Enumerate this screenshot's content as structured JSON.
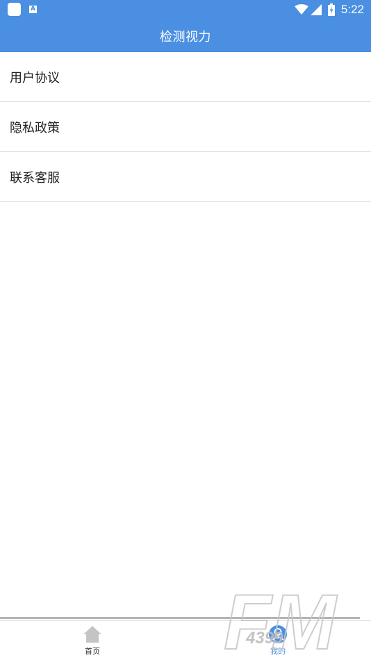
{
  "colors": {
    "header_bg": "#4a8fe2",
    "accent": "#4a8fe2",
    "divider": "#d6d6d6",
    "text": "#222222"
  },
  "status_bar": {
    "time": "5:22",
    "notification_icons": [
      "app-icon",
      "a-icon"
    ],
    "a_icon_letter": "A",
    "system_icons": [
      "wifi-icon",
      "signal-icon",
      "battery-icon"
    ]
  },
  "app_bar": {
    "title": "检测视力"
  },
  "menu": {
    "items": [
      {
        "label": "用户协议"
      },
      {
        "label": "隐私政策"
      },
      {
        "label": "联系客服"
      }
    ]
  },
  "bottom_nav": {
    "tabs": [
      {
        "label": "首页",
        "icon": "home-icon",
        "selected": false
      },
      {
        "label": "我的",
        "icon": "user-icon",
        "selected": true
      }
    ]
  },
  "watermark": {
    "brand": "FM",
    "number": "4399"
  }
}
